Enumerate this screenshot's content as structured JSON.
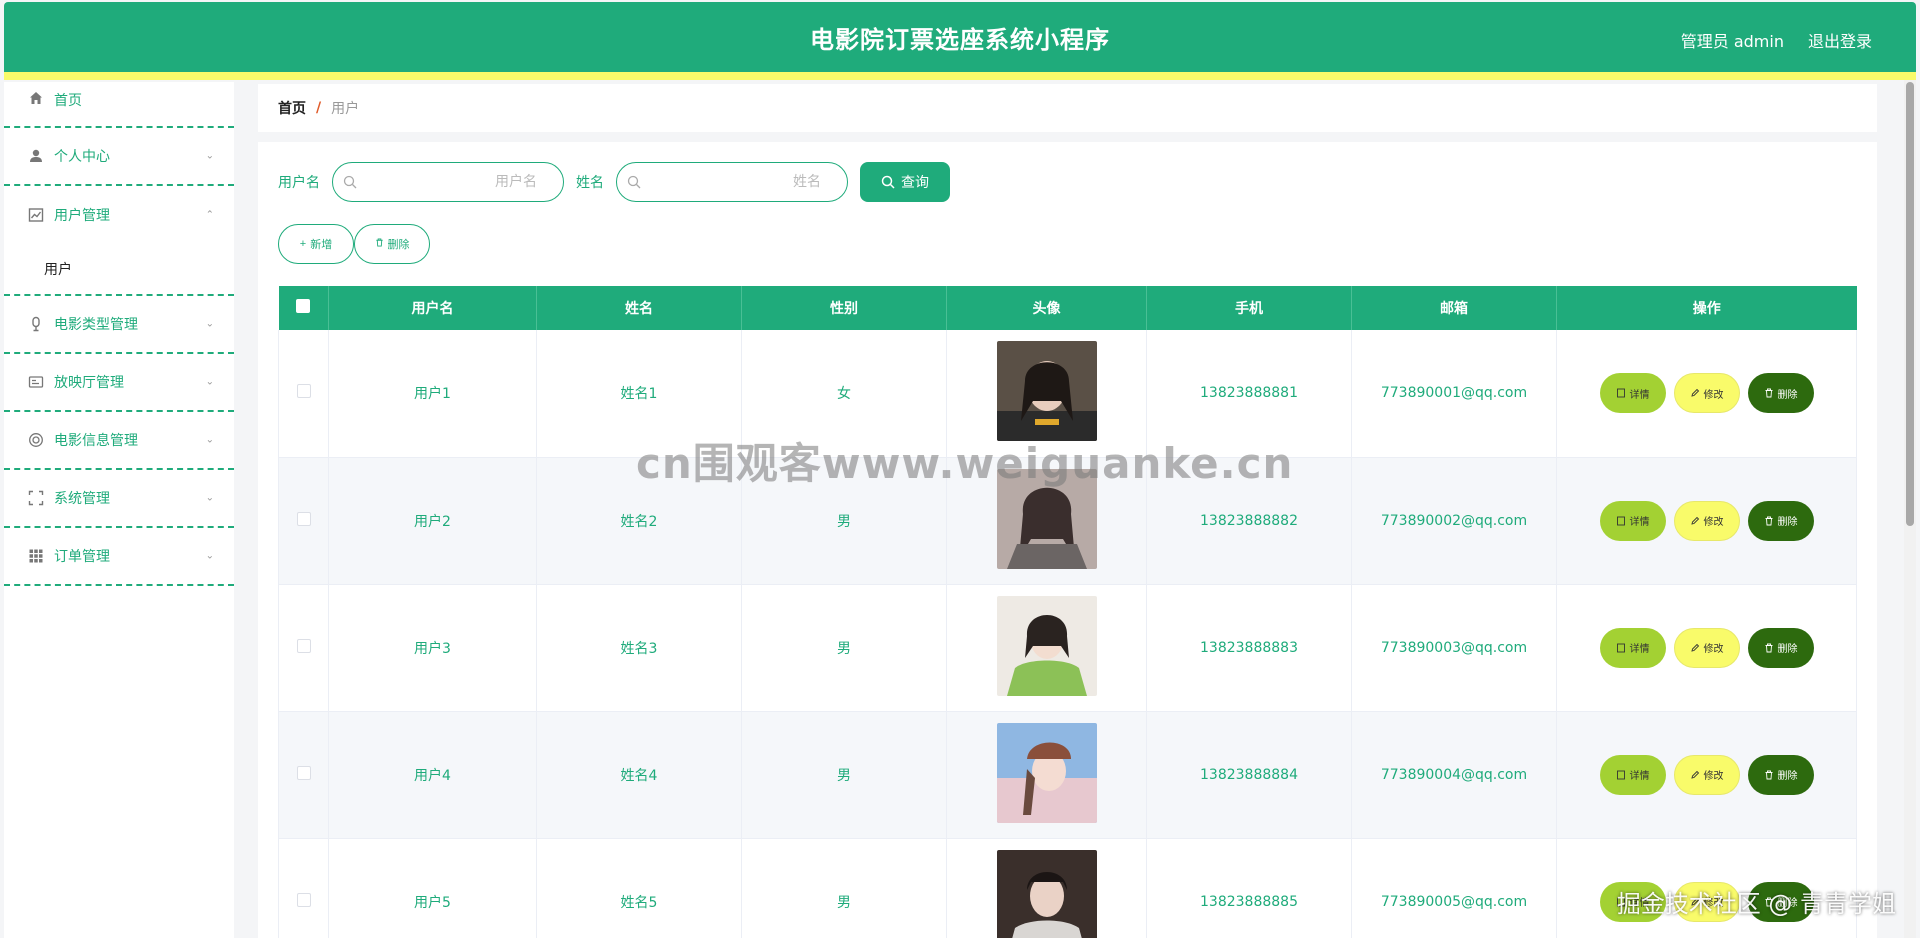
{
  "header": {
    "title": "电影院订票选座系统小程序",
    "admin_label": "管理员 admin",
    "logout_label": "退出登录"
  },
  "sidebar": {
    "items": [
      {
        "label": "首页",
        "icon": "home-icon"
      },
      {
        "label": "个人中心",
        "icon": "user-icon"
      },
      {
        "label": "用户管理",
        "icon": "chart-icon",
        "open": true,
        "children": [
          {
            "label": "用户"
          }
        ]
      },
      {
        "label": "电影类型管理",
        "icon": "mic-icon"
      },
      {
        "label": "放映厅管理",
        "icon": "card-icon"
      },
      {
        "label": "电影信息管理",
        "icon": "circle-icon"
      },
      {
        "label": "系统管理",
        "icon": "frame-icon"
      },
      {
        "label": "订单管理",
        "icon": "grid-icon"
      }
    ]
  },
  "breadcrumb": {
    "home": "首页",
    "sep": "/",
    "current": "用户"
  },
  "search": {
    "username_label": "用户名",
    "username_placeholder": "用户名",
    "name_label": "姓名",
    "name_placeholder": "姓名",
    "query_label": "查询"
  },
  "actions": {
    "add_label": "新增",
    "delete_label": "删除"
  },
  "table": {
    "columns": [
      "用户名",
      "姓名",
      "性别",
      "头像",
      "手机",
      "邮箱",
      "操作"
    ],
    "rows": [
      {
        "username": "用户1",
        "name": "姓名1",
        "gender": "女",
        "phone": "13823888881",
        "email": "773890001@qq.com"
      },
      {
        "username": "用户2",
        "name": "姓名2",
        "gender": "男",
        "phone": "13823888882",
        "email": "773890002@qq.com"
      },
      {
        "username": "用户3",
        "name": "姓名3",
        "gender": "男",
        "phone": "13823888883",
        "email": "773890003@qq.com"
      },
      {
        "username": "用户4",
        "name": "姓名4",
        "gender": "男",
        "phone": "13823888884",
        "email": "773890004@qq.com"
      },
      {
        "username": "用户5",
        "name": "姓名5",
        "gender": "男",
        "phone": "13823888885",
        "email": "773890005@qq.com"
      }
    ],
    "op_detail": "详情",
    "op_edit": "修改",
    "op_delete": "删除"
  },
  "watermarks": {
    "center": "cn围观客www.weiguanke.cn",
    "bottom_right": "掘金技术社区 @ 青青学姐"
  },
  "colors": {
    "primary": "#1fab7b",
    "accent_yellow": "#f9fb6a",
    "detail_btn": "#a3d133",
    "delete_btn": "#2d6a0e"
  }
}
